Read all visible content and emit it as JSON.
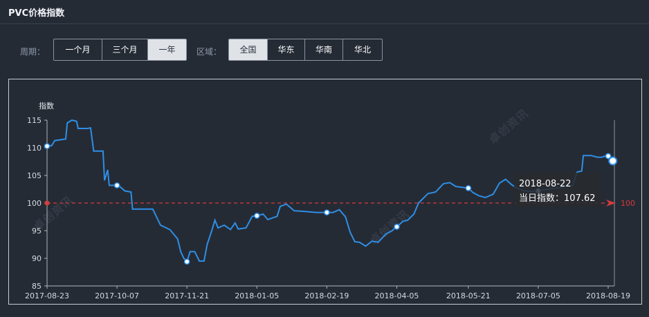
{
  "page": {
    "title": "PVC价格指数"
  },
  "filters": {
    "period_label": "周期：",
    "period_options": [
      "一个月",
      "三个月",
      "一年"
    ],
    "period_selected": "一年",
    "region_label": "区域：",
    "region_options": [
      "全国",
      "华东",
      "华南",
      "华北"
    ],
    "region_selected": "全国"
  },
  "watermark": {
    "text": "卓创资讯"
  },
  "tooltip": {
    "date": "2018-08-22",
    "label": "当日指数：",
    "value": "107.62"
  },
  "colors": {
    "line": "#2e8fe6",
    "baseline": "#d63b3b",
    "background": "#252b35"
  },
  "chart_data": {
    "type": "line",
    "ylabel": "指数",
    "ylim": [
      85,
      115
    ],
    "yticks": [
      85,
      90,
      95,
      100,
      105,
      110,
      115
    ],
    "xlim": [
      "2017-08-23",
      "2018-08-23"
    ],
    "xticks": [
      "2017-08-23",
      "2017-10-07",
      "2017-11-21",
      "2018-01-05",
      "2018-02-19",
      "2018-04-05",
      "2018-05-21",
      "2018-07-05",
      "2018-08-19"
    ],
    "baseline": {
      "value": 100,
      "label": "100"
    },
    "series": [
      {
        "points": [
          [
            "2017-08-23",
            110.3
          ],
          [
            "2017-08-26",
            110.4
          ],
          [
            "2017-08-28",
            111.3
          ],
          [
            "2017-09-04",
            111.6
          ],
          [
            "2017-09-05",
            114.5
          ],
          [
            "2017-09-08",
            115.0
          ],
          [
            "2017-09-11",
            114.8
          ],
          [
            "2017-09-12",
            113.5
          ],
          [
            "2017-09-18",
            113.5
          ],
          [
            "2017-09-20",
            113.6
          ],
          [
            "2017-09-22",
            109.4
          ],
          [
            "2017-09-28",
            109.4
          ],
          [
            "2017-09-29",
            104.1
          ],
          [
            "2017-10-01",
            106.0
          ],
          [
            "2017-10-02",
            103.2
          ],
          [
            "2017-10-08",
            103.2
          ],
          [
            "2017-10-12",
            102.2
          ],
          [
            "2017-10-16",
            102.0
          ],
          [
            "2017-10-17",
            98.9
          ],
          [
            "2017-10-30",
            98.9
          ],
          [
            "2017-11-04",
            96.0
          ],
          [
            "2017-11-10",
            95.2
          ],
          [
            "2017-11-15",
            93.5
          ],
          [
            "2017-11-17",
            91.2
          ],
          [
            "2017-11-19",
            90.0
          ],
          [
            "2017-11-21",
            89.4
          ],
          [
            "2017-11-23",
            91.2
          ],
          [
            "2017-11-26",
            91.2
          ],
          [
            "2017-11-29",
            89.5
          ],
          [
            "2017-12-02",
            89.5
          ],
          [
            "2017-12-04",
            92.5
          ],
          [
            "2017-12-07",
            95.0
          ],
          [
            "2017-12-09",
            96.9
          ],
          [
            "2017-12-11",
            95.5
          ],
          [
            "2017-12-15",
            96.0
          ],
          [
            "2017-12-19",
            95.2
          ],
          [
            "2017-12-22",
            96.4
          ],
          [
            "2017-12-24",
            95.3
          ],
          [
            "2017-12-29",
            95.5
          ],
          [
            "2018-01-02",
            97.6
          ],
          [
            "2018-01-05",
            97.7
          ],
          [
            "2018-01-09",
            98.0
          ],
          [
            "2018-01-12",
            97.0
          ],
          [
            "2018-01-18",
            97.6
          ],
          [
            "2018-01-20",
            99.4
          ],
          [
            "2018-01-24",
            99.8
          ],
          [
            "2018-01-29",
            98.6
          ],
          [
            "2018-02-04",
            98.5
          ],
          [
            "2018-02-12",
            98.3
          ],
          [
            "2018-02-19",
            98.3
          ],
          [
            "2018-02-23",
            98.3
          ],
          [
            "2018-02-27",
            98.8
          ],
          [
            "2018-03-03",
            97.5
          ],
          [
            "2018-03-06",
            94.7
          ],
          [
            "2018-03-09",
            93.0
          ],
          [
            "2018-03-12",
            92.9
          ],
          [
            "2018-03-16",
            92.2
          ],
          [
            "2018-03-20",
            93.1
          ],
          [
            "2018-03-24",
            92.9
          ],
          [
            "2018-03-29",
            94.4
          ],
          [
            "2018-04-02",
            95.0
          ],
          [
            "2018-04-05",
            95.7
          ],
          [
            "2018-04-09",
            96.7
          ],
          [
            "2018-04-12",
            96.9
          ],
          [
            "2018-04-16",
            98.0
          ],
          [
            "2018-04-19",
            100.0
          ],
          [
            "2018-04-25",
            101.7
          ],
          [
            "2018-04-30",
            102.0
          ],
          [
            "2018-05-05",
            103.5
          ],
          [
            "2018-05-09",
            103.7
          ],
          [
            "2018-05-13",
            103.0
          ],
          [
            "2018-05-21",
            102.7
          ],
          [
            "2018-05-24",
            101.9
          ],
          [
            "2018-05-28",
            101.3
          ],
          [
            "2018-06-01",
            101.0
          ],
          [
            "2018-06-06",
            101.6
          ],
          [
            "2018-06-10",
            103.6
          ],
          [
            "2018-06-14",
            104.3
          ],
          [
            "2018-06-18",
            103.3
          ],
          [
            "2018-06-22",
            102.6
          ],
          [
            "2018-06-26",
            102.2
          ],
          [
            "2018-06-30",
            102.1
          ],
          [
            "2018-07-05",
            102.2
          ],
          [
            "2018-07-12",
            102.5
          ],
          [
            "2018-07-19",
            102.8
          ],
          [
            "2018-07-24",
            103.1
          ],
          [
            "2018-07-27",
            103.1
          ],
          [
            "2018-07-30",
            105.6
          ],
          [
            "2018-08-02",
            105.8
          ],
          [
            "2018-08-03",
            108.6
          ],
          [
            "2018-08-08",
            108.6
          ],
          [
            "2018-08-12",
            108.3
          ],
          [
            "2018-08-15",
            108.3
          ],
          [
            "2018-08-17",
            108.5
          ],
          [
            "2018-08-22",
            107.6
          ]
        ],
        "markers": [
          [
            "2017-08-23",
            110.3
          ],
          [
            "2017-10-07",
            103.2
          ],
          [
            "2017-11-21",
            89.4
          ],
          [
            "2018-01-05",
            97.7
          ],
          [
            "2018-02-19",
            98.3
          ],
          [
            "2018-04-05",
            95.7
          ],
          [
            "2018-05-21",
            102.7
          ],
          [
            "2018-07-05",
            102.2
          ],
          [
            "2018-08-19",
            108.5
          ]
        ],
        "highlight": [
          "2018-08-22",
          107.62
        ]
      }
    ]
  }
}
